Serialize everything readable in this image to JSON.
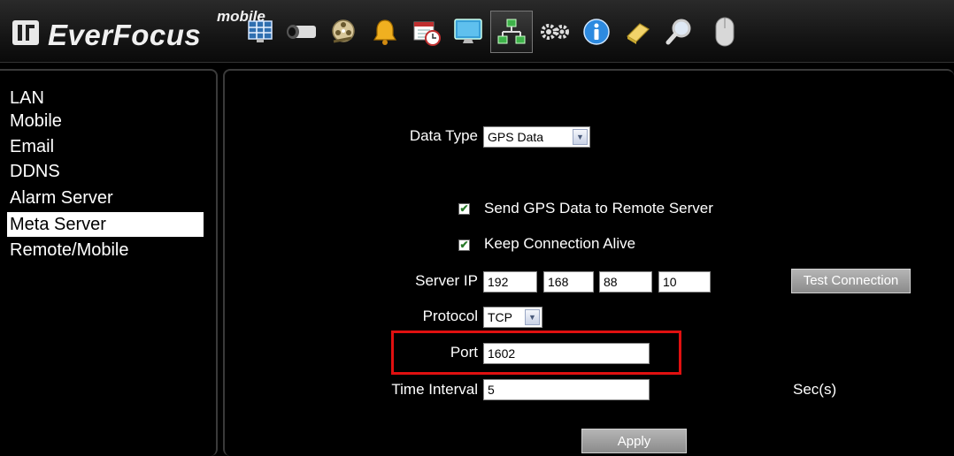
{
  "brand": {
    "name": "EverFocus",
    "suffix": "mobile"
  },
  "toolbar": {
    "items": [
      {
        "name": "live-view-grid-icon"
      },
      {
        "name": "camera-icon"
      },
      {
        "name": "film-reel-icon"
      },
      {
        "name": "alarm-bell-icon"
      },
      {
        "name": "schedule-calendar-icon"
      },
      {
        "name": "monitor-icon"
      },
      {
        "name": "network-icon",
        "active": true
      },
      {
        "name": "settings-gears-icon"
      },
      {
        "name": "info-icon"
      },
      {
        "name": "eraser-icon"
      },
      {
        "name": "search-icon"
      },
      {
        "name": "mouse-icon"
      }
    ]
  },
  "sidebar": {
    "items": [
      {
        "label": "LAN"
      },
      {
        "label": "Mobile"
      },
      {
        "label": "Email"
      },
      {
        "label": "DDNS"
      },
      {
        "label": "Alarm Server"
      },
      {
        "label": "Meta Server",
        "selected": true
      },
      {
        "label": "Remote/Mobile"
      }
    ]
  },
  "form": {
    "data_type": {
      "label": "Data Type",
      "value": "GPS Data"
    },
    "send_gps": {
      "label": "Send GPS Data to Remote Server",
      "checked": true
    },
    "keep_alive": {
      "label": "Keep Connection Alive",
      "checked": true
    },
    "server_ip": {
      "label": "Server IP",
      "octets": [
        "192",
        "168",
        "88",
        "10"
      ]
    },
    "test_connection_label": "Test Connection",
    "protocol": {
      "label": "Protocol",
      "value": "TCP"
    },
    "port": {
      "label": "Port",
      "value": "1602"
    },
    "time_interval": {
      "label": "Time Interval",
      "value": "5",
      "unit": "Sec(s)"
    },
    "apply_label": "Apply"
  },
  "colors": {
    "highlight": "#e01010",
    "selected_bg": "#ffffff"
  }
}
